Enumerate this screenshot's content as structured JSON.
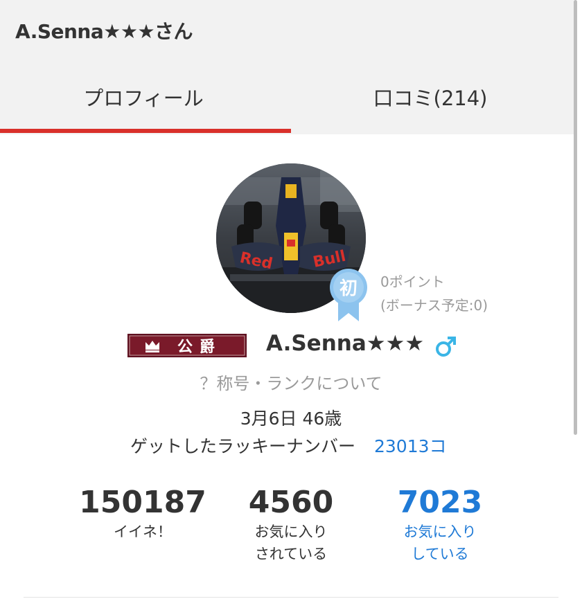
{
  "header": {
    "title": "A.Senna★★★さん",
    "tabs": [
      {
        "label": "プロフィール",
        "active": true
      },
      {
        "label": "口コミ(214)",
        "active": false
      }
    ]
  },
  "profile": {
    "badge_label": "初",
    "points": "0ポイント",
    "bonus": "(ボーナス予定:0)",
    "rank_title": "公爵",
    "username": "A.Senna★★★",
    "gender_symbol": "♂",
    "about_rank": "？称号・ランクについて",
    "birthday_age": "3月6日 46歳",
    "lucky_label": "ゲットしたラッキーナンバー",
    "lucky_count": "23013コ"
  },
  "stats": [
    {
      "value": "150187",
      "label": "イイネ！"
    },
    {
      "value": "4560",
      "label": "お気に入り\nされている"
    },
    {
      "value": "7023",
      "label": "お気に入り\nしている"
    }
  ],
  "colors": {
    "accent_red": "#d9302a",
    "link_blue": "#1f7ad6",
    "badge_blue": "#8cc3ee",
    "gender_blue": "#3ab5e6",
    "rank_plate": "#7a1a2a"
  },
  "icons": {
    "badge": "first-timer-ribbon-icon",
    "gender": "male-icon",
    "crown": "crown-icon"
  }
}
